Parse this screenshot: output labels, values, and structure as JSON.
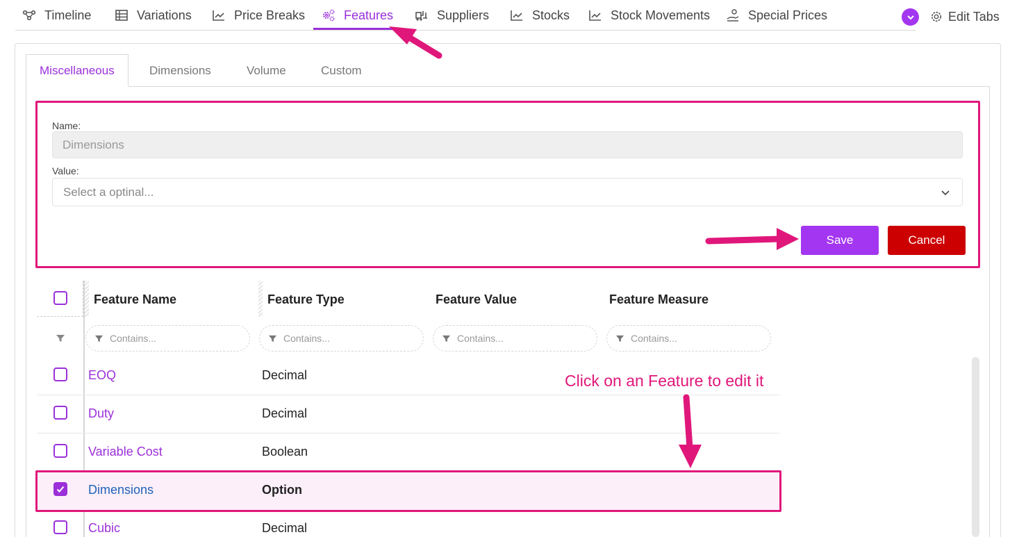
{
  "topnav": {
    "tabs": [
      {
        "label": "Timeline",
        "icon": "timeline-icon"
      },
      {
        "label": "Variations",
        "icon": "table-icon"
      },
      {
        "label": "Price Breaks",
        "icon": "chart-icon"
      },
      {
        "label": "Features",
        "icon": "gears-icon",
        "active": true
      },
      {
        "label": "Suppliers",
        "icon": "forklift-icon"
      },
      {
        "label": "Stocks",
        "icon": "chart-icon"
      },
      {
        "label": "Stock Movements",
        "icon": "chart-icon"
      },
      {
        "label": "Special Prices",
        "icon": "hand-coins-icon"
      }
    ],
    "edit_tabs_label": "Edit Tabs"
  },
  "subtabs": [
    "Miscellaneous",
    "Dimensions",
    "Volume",
    "Custom"
  ],
  "form": {
    "name_label": "Name:",
    "name_value": "Dimensions",
    "value_label": "Value:",
    "value_placeholder": "Select a optinal...",
    "save_label": "Save",
    "cancel_label": "Cancel"
  },
  "grid": {
    "columns": [
      "Feature Name",
      "Feature Type",
      "Feature Value",
      "Feature Measure"
    ],
    "filter_placeholder": "Contains...",
    "rows": [
      {
        "name": "EOQ",
        "type": "Decimal",
        "selected": false
      },
      {
        "name": "Duty",
        "type": "Decimal",
        "selected": false
      },
      {
        "name": "Variable Cost",
        "type": "Boolean",
        "selected": false
      },
      {
        "name": "Dimensions",
        "type": "Option",
        "selected": true
      },
      {
        "name": "Cubic",
        "type": "Decimal",
        "selected": false
      }
    ]
  },
  "annotation": {
    "text": "Click on an Feature to edit it"
  },
  "colors": {
    "accent": "#a336f0",
    "highlight": "#e0177a",
    "danger": "#cc0000",
    "selected_row_bg": "#fdeffa"
  }
}
